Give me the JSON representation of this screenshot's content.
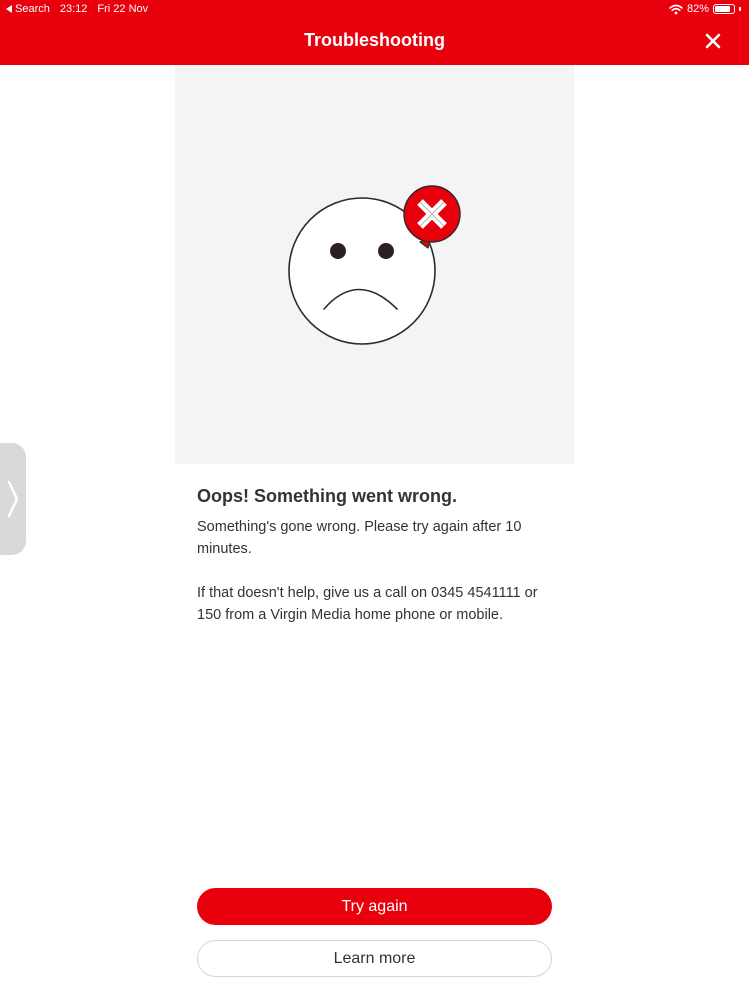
{
  "status_bar": {
    "back_label": "Search",
    "time": "23:12",
    "date": "Fri 22 Nov",
    "battery_percent": "82%",
    "battery_level": 0.82
  },
  "header": {
    "title": "Troubleshooting"
  },
  "illustration": {
    "icons": [
      "sad-face-icon",
      "error-x-icon"
    ],
    "colors": {
      "background": "#f4f4f4",
      "error_badge": "#e8000c"
    }
  },
  "message": {
    "heading": "Oops! Something went wrong.",
    "body_line1": "Something's gone wrong. Please try again after 10 minutes.",
    "body_line2": "If that doesn't help, give us a call on 0345 4541111 or 150 from a Virgin Media home phone or mobile."
  },
  "actions": {
    "primary_label": "Try again",
    "secondary_label": "Learn more"
  },
  "colors": {
    "brand": "#e8000c",
    "text": "#333333"
  }
}
